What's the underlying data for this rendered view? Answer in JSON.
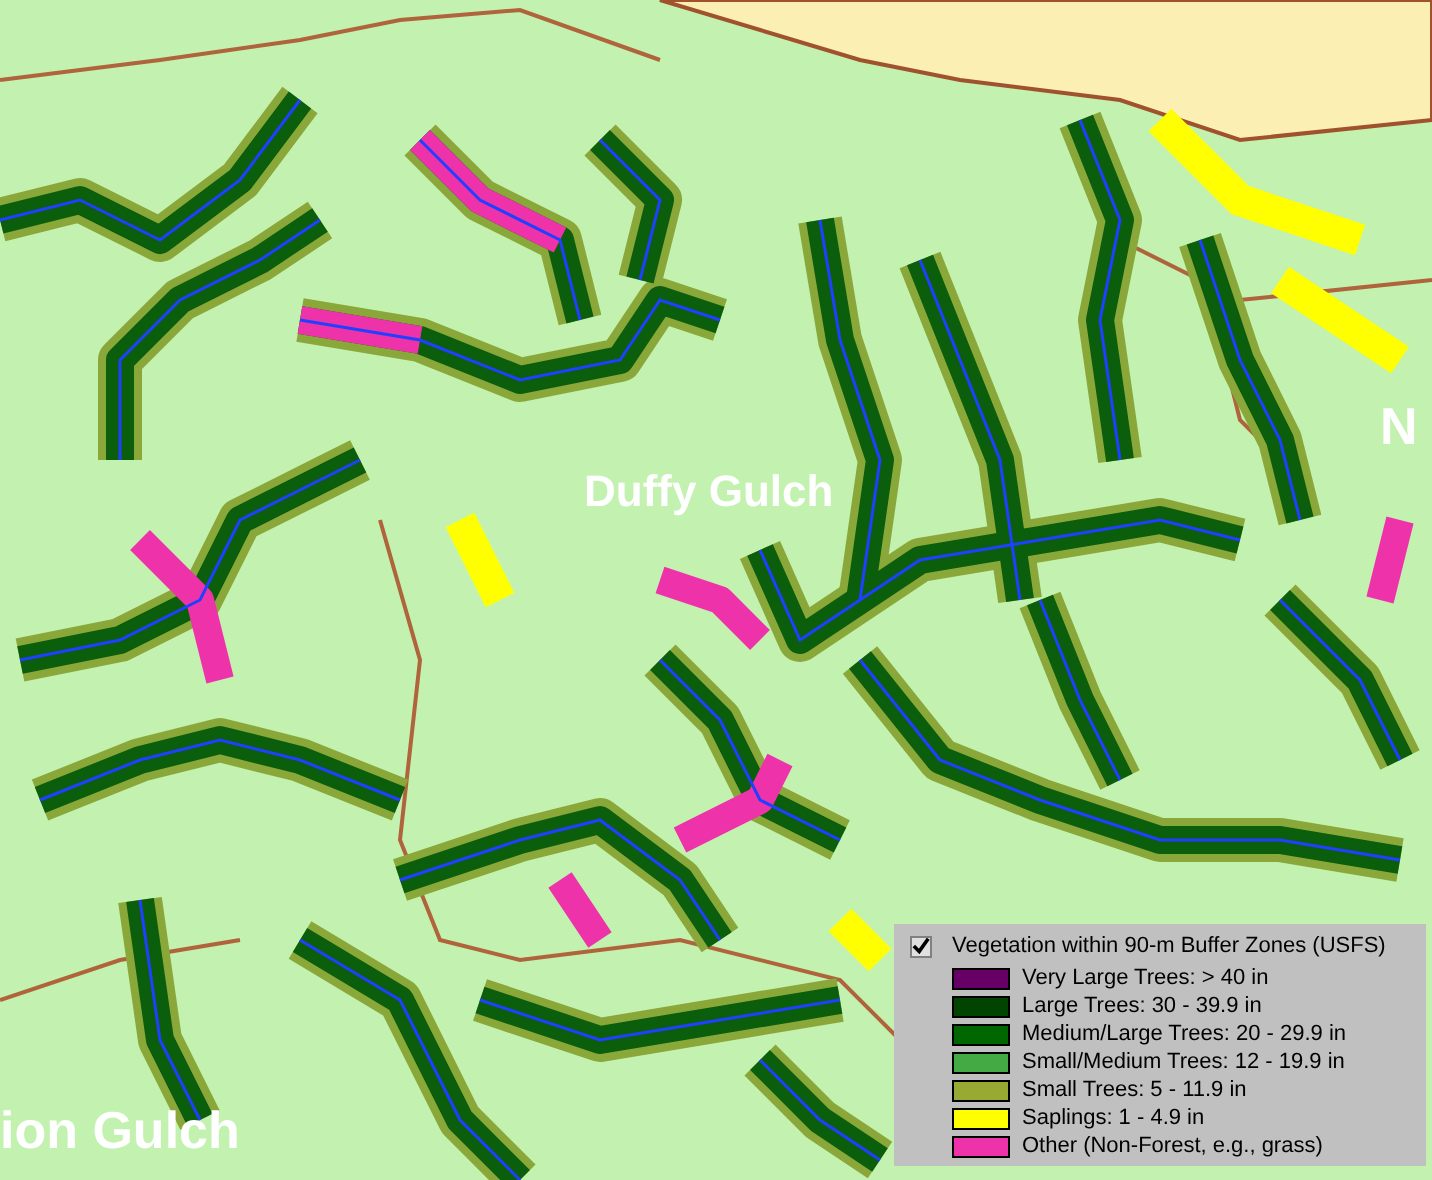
{
  "map": {
    "labels": [
      {
        "text": "Duffy Gulch"
      },
      {
        "text": "ion Gulch"
      },
      {
        "text": "N"
      }
    ]
  },
  "legend": {
    "checked": true,
    "title": "Vegetation within 90-m Buffer Zones (USFS)",
    "items": [
      {
        "label": "Very Large Trees: > 40  in",
        "color": "#660066"
      },
      {
        "label": "Large Trees: 30 - 39.9 in",
        "color": "#004400"
      },
      {
        "label": "Medium/Large Trees: 20 - 29.9 in",
        "color": "#006600"
      },
      {
        "label": "Small/Medium Trees: 12 - 19.9 in",
        "color": "#44aa44"
      },
      {
        "label": "Small Trees: 5 - 11.9 in",
        "color": "#99aa33"
      },
      {
        "label": "Saplings: 1 - 4.9 in",
        "color": "#ffff00"
      },
      {
        "label": "Other (Non-Forest, e.g., grass)",
        "color": "#ee33aa"
      }
    ]
  }
}
